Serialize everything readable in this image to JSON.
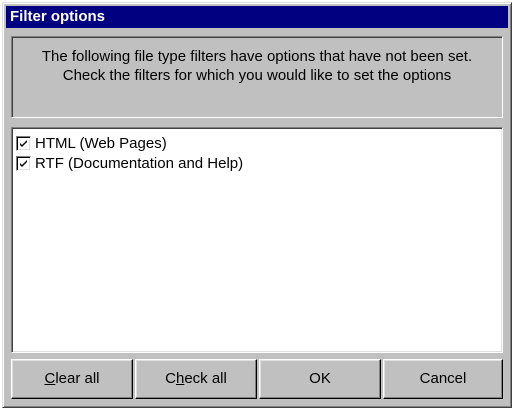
{
  "window": {
    "title": "Filter options"
  },
  "info": {
    "text": "The following file type filters have options that have not been set.  Check the filters for which you would like to set the options"
  },
  "list": {
    "items": [
      {
        "label": "HTML (Web Pages)",
        "checked": true
      },
      {
        "label": "RTF (Documentation and Help)",
        "checked": true
      }
    ]
  },
  "buttons": {
    "clear_all": {
      "mnemonic": "C",
      "rest": "lear all"
    },
    "check_all": {
      "prefix": "C",
      "mnemonic": "h",
      "rest": "eck all"
    },
    "ok": "OK",
    "cancel": "Cancel"
  },
  "colors": {
    "titlebar": "#000080",
    "face": "#c0c0c0"
  }
}
